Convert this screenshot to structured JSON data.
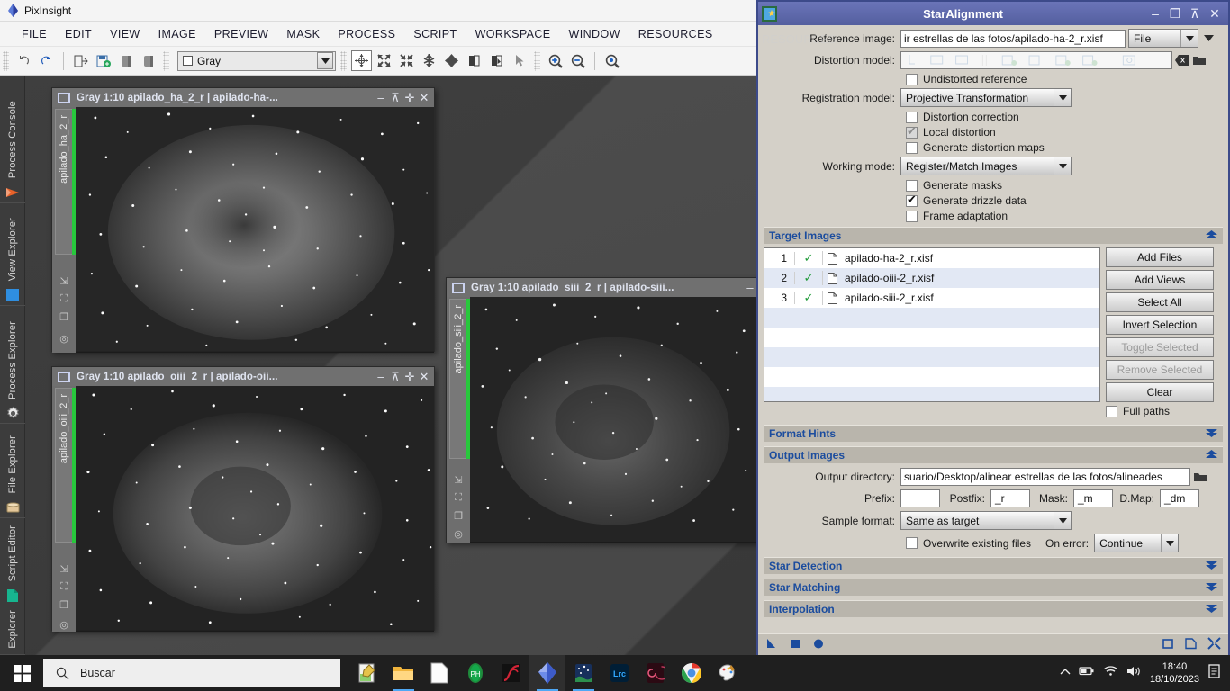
{
  "app": {
    "title": "PixInsight",
    "menu": [
      "FILE",
      "EDIT",
      "VIEW",
      "IMAGE",
      "PREVIEW",
      "MASK",
      "PROCESS",
      "SCRIPT",
      "WORKSPACE",
      "WINDOW",
      "RESOURCES"
    ],
    "view_selector": "Gray",
    "ghost_text": "RESOURCES"
  },
  "rail": [
    {
      "label": "Process Console",
      "icon": "cone-icon"
    },
    {
      "label": "View Explorer",
      "icon": "blue-square-icon"
    },
    {
      "label": "Process Explorer",
      "icon": "gear-icon"
    },
    {
      "label": "File Explorer",
      "icon": "folder-cylinder-icon"
    },
    {
      "label": "Script Editor",
      "icon": "green-page-icon"
    },
    {
      "label": "Explorer",
      "icon": "none"
    }
  ],
  "image_windows": [
    {
      "title": "Gray 1:10 apilado_ha_2_r | apilado-ha-...",
      "tab_label": "apilado_ha_2_r"
    },
    {
      "title": "Gray 1:10 apilado_oiii_2_r | apilado-oii...",
      "tab_label": "apilado_oiii_2_r"
    },
    {
      "title": "Gray 1:10 apilado_siii_2_r | apilado-siii...",
      "tab_label": "apilado_siii_2_r"
    }
  ],
  "dialog": {
    "title": "StarAlignment",
    "reference_image": {
      "label": "Reference image:",
      "value": "ir estrellas de las fotos/apilado-ha-2_r.xisf",
      "mode": "File"
    },
    "distortion_model": {
      "label": "Distortion model:",
      "value": ""
    },
    "undistorted_reference": {
      "label": "Undistorted reference",
      "checked": false
    },
    "registration_model": {
      "label": "Registration model:",
      "value": "Projective Transformation"
    },
    "distortion_correction": {
      "label": "Distortion correction",
      "checked": false
    },
    "local_distortion": {
      "label": "Local distortion",
      "checked": true,
      "disabled": true
    },
    "generate_distortion_maps": {
      "label": "Generate distortion maps",
      "checked": false
    },
    "working_mode": {
      "label": "Working mode:",
      "value": "Register/Match Images"
    },
    "generate_masks": {
      "label": "Generate masks",
      "checked": false
    },
    "generate_drizzle_data": {
      "label": "Generate drizzle data",
      "checked": true
    },
    "frame_adaptation": {
      "label": "Frame adaptation",
      "checked": false
    },
    "target_images": {
      "section_title": "Target Images",
      "rows": [
        {
          "num": "1",
          "check": "✓",
          "name": "apilado-ha-2_r.xisf"
        },
        {
          "num": "2",
          "check": "✓",
          "name": "apilado-oiii-2_r.xisf"
        },
        {
          "num": "3",
          "check": "✓",
          "name": "apilado-siii-2_r.xisf"
        }
      ],
      "buttons": [
        {
          "label": "Add Files",
          "enabled": true
        },
        {
          "label": "Add Views",
          "enabled": true
        },
        {
          "label": "Select All",
          "enabled": true
        },
        {
          "label": "Invert Selection",
          "enabled": true
        },
        {
          "label": "Toggle Selected",
          "enabled": false
        },
        {
          "label": "Remove Selected",
          "enabled": false
        },
        {
          "label": "Clear",
          "enabled": true
        }
      ],
      "full_paths": {
        "label": "Full paths",
        "checked": false
      }
    },
    "format_hints": {
      "section_title": "Format Hints"
    },
    "output_images": {
      "section_title": "Output Images",
      "output_directory": {
        "label": "Output directory:",
        "value": "suario/Desktop/alinear estrellas de las fotos/alineades"
      },
      "prefix": {
        "label": "Prefix:",
        "value": ""
      },
      "postfix": {
        "label": "Postfix:",
        "value": "_r"
      },
      "mask": {
        "label": "Mask:",
        "value": "_m"
      },
      "dmap": {
        "label": "D.Map:",
        "value": "_dm"
      },
      "sample_format": {
        "label": "Sample format:",
        "value": "Same as target"
      },
      "overwrite": {
        "label": "Overwrite existing files",
        "checked": false
      },
      "on_error": {
        "label": "On error:",
        "value": "Continue"
      }
    },
    "star_detection": {
      "section_title": "Star Detection"
    },
    "star_matching": {
      "section_title": "Star Matching"
    },
    "interpolation": {
      "section_title": "Interpolation"
    }
  },
  "taskbar": {
    "search_placeholder": "Buscar",
    "time": "18:40",
    "date": "18/10/2023",
    "items": [
      {
        "name": "notepad-editor-icon"
      },
      {
        "name": "file-explorer-icon"
      },
      {
        "name": "blank-document-icon"
      },
      {
        "name": "photo-tool-icon"
      },
      {
        "name": "curves-app-icon"
      },
      {
        "name": "pixinsight-icon"
      },
      {
        "name": "night-sky-app-icon"
      },
      {
        "name": "lightroom-classic-icon"
      },
      {
        "name": "spiral-app-icon"
      },
      {
        "name": "chrome-icon"
      },
      {
        "name": "paint-icon"
      }
    ]
  },
  "colors": {
    "accent": "#1b4c9e",
    "dialog_titlebar": "#545f9f",
    "check_green": "#1f9b39",
    "active_green": "#28c83c"
  }
}
